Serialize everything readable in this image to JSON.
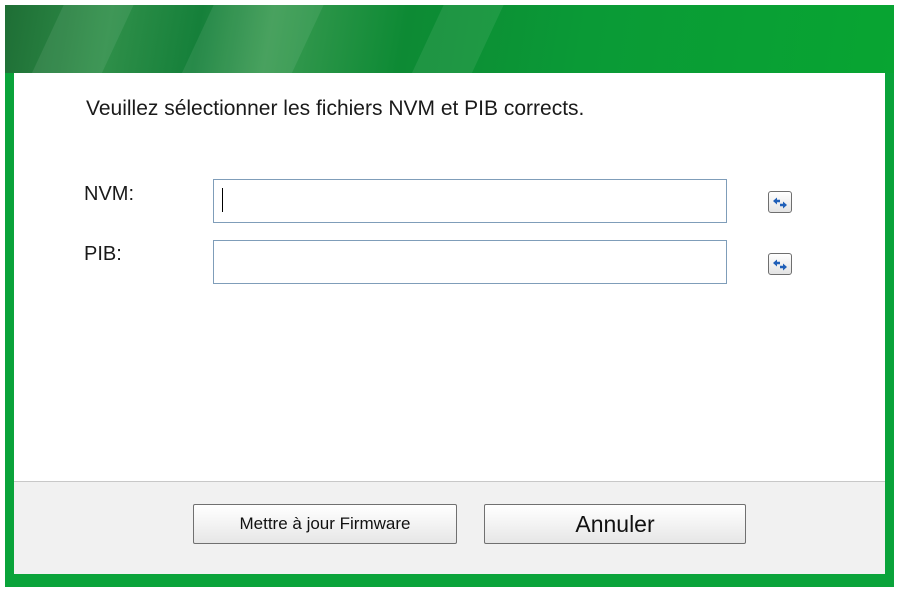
{
  "dialog": {
    "instruction": "Veuillez sélectionner les fichiers NVM et PIB corrects.",
    "fields": {
      "nvm": {
        "label": "NVM:",
        "value": "",
        "placeholder": ""
      },
      "pib": {
        "label": "PIB:",
        "value": "",
        "placeholder": ""
      }
    },
    "browse_icon": "browse-arrows-icon",
    "buttons": {
      "update": "Mettre à jour Firmware",
      "cancel": "Annuler"
    }
  },
  "colors": {
    "frame": "#0aa33a",
    "title_dark": "#1e6e35",
    "input_border": "#7f9db9",
    "footer_bg": "#f1f1f1",
    "icon_blue": "#1f5fb8"
  }
}
